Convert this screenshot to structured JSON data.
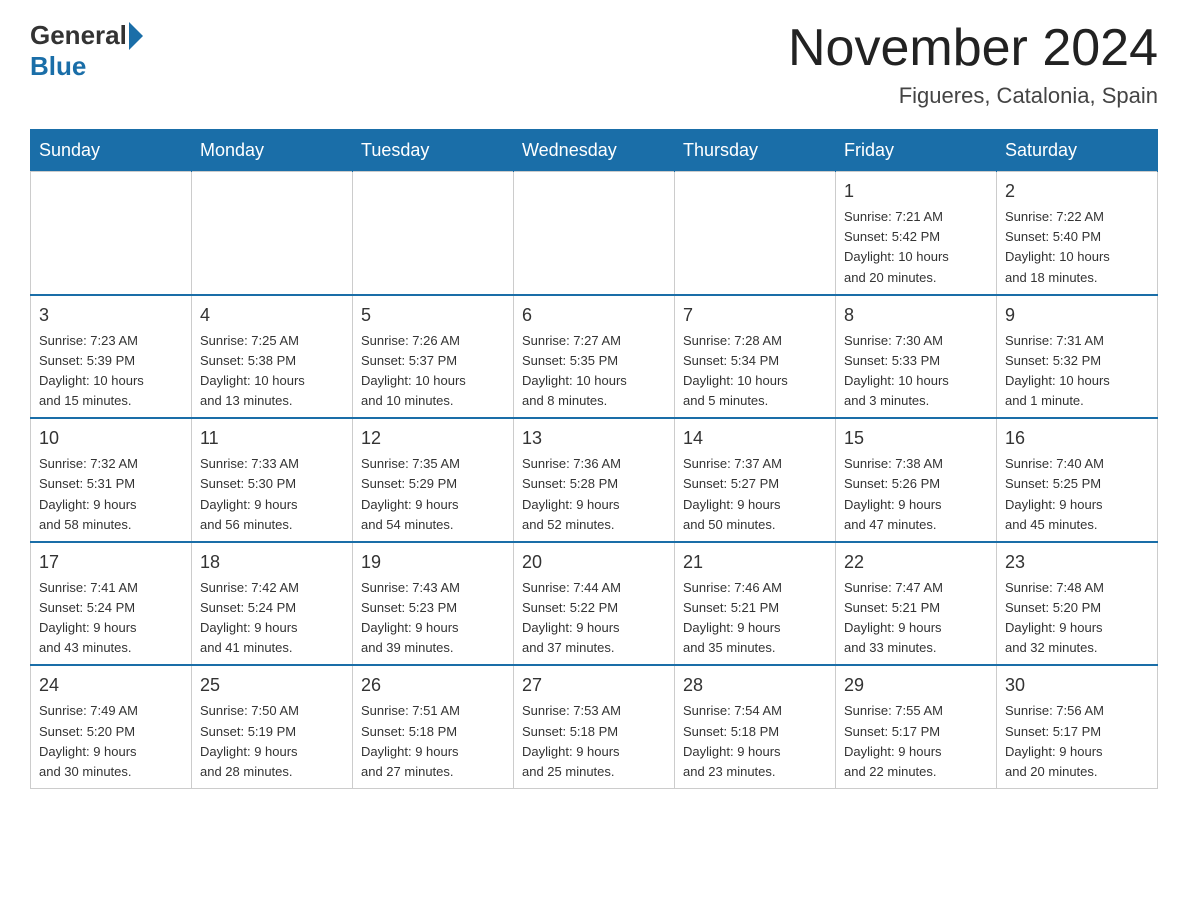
{
  "header": {
    "logo_general": "General",
    "logo_blue": "Blue",
    "title": "November 2024",
    "subtitle": "Figueres, Catalonia, Spain"
  },
  "weekdays": [
    "Sunday",
    "Monday",
    "Tuesday",
    "Wednesday",
    "Thursday",
    "Friday",
    "Saturday"
  ],
  "weeks": [
    [
      {
        "day": "",
        "info": ""
      },
      {
        "day": "",
        "info": ""
      },
      {
        "day": "",
        "info": ""
      },
      {
        "day": "",
        "info": ""
      },
      {
        "day": "",
        "info": ""
      },
      {
        "day": "1",
        "info": "Sunrise: 7:21 AM\nSunset: 5:42 PM\nDaylight: 10 hours\nand 20 minutes."
      },
      {
        "day": "2",
        "info": "Sunrise: 7:22 AM\nSunset: 5:40 PM\nDaylight: 10 hours\nand 18 minutes."
      }
    ],
    [
      {
        "day": "3",
        "info": "Sunrise: 7:23 AM\nSunset: 5:39 PM\nDaylight: 10 hours\nand 15 minutes."
      },
      {
        "day": "4",
        "info": "Sunrise: 7:25 AM\nSunset: 5:38 PM\nDaylight: 10 hours\nand 13 minutes."
      },
      {
        "day": "5",
        "info": "Sunrise: 7:26 AM\nSunset: 5:37 PM\nDaylight: 10 hours\nand 10 minutes."
      },
      {
        "day": "6",
        "info": "Sunrise: 7:27 AM\nSunset: 5:35 PM\nDaylight: 10 hours\nand 8 minutes."
      },
      {
        "day": "7",
        "info": "Sunrise: 7:28 AM\nSunset: 5:34 PM\nDaylight: 10 hours\nand 5 minutes."
      },
      {
        "day": "8",
        "info": "Sunrise: 7:30 AM\nSunset: 5:33 PM\nDaylight: 10 hours\nand 3 minutes."
      },
      {
        "day": "9",
        "info": "Sunrise: 7:31 AM\nSunset: 5:32 PM\nDaylight: 10 hours\nand 1 minute."
      }
    ],
    [
      {
        "day": "10",
        "info": "Sunrise: 7:32 AM\nSunset: 5:31 PM\nDaylight: 9 hours\nand 58 minutes."
      },
      {
        "day": "11",
        "info": "Sunrise: 7:33 AM\nSunset: 5:30 PM\nDaylight: 9 hours\nand 56 minutes."
      },
      {
        "day": "12",
        "info": "Sunrise: 7:35 AM\nSunset: 5:29 PM\nDaylight: 9 hours\nand 54 minutes."
      },
      {
        "day": "13",
        "info": "Sunrise: 7:36 AM\nSunset: 5:28 PM\nDaylight: 9 hours\nand 52 minutes."
      },
      {
        "day": "14",
        "info": "Sunrise: 7:37 AM\nSunset: 5:27 PM\nDaylight: 9 hours\nand 50 minutes."
      },
      {
        "day": "15",
        "info": "Sunrise: 7:38 AM\nSunset: 5:26 PM\nDaylight: 9 hours\nand 47 minutes."
      },
      {
        "day": "16",
        "info": "Sunrise: 7:40 AM\nSunset: 5:25 PM\nDaylight: 9 hours\nand 45 minutes."
      }
    ],
    [
      {
        "day": "17",
        "info": "Sunrise: 7:41 AM\nSunset: 5:24 PM\nDaylight: 9 hours\nand 43 minutes."
      },
      {
        "day": "18",
        "info": "Sunrise: 7:42 AM\nSunset: 5:24 PM\nDaylight: 9 hours\nand 41 minutes."
      },
      {
        "day": "19",
        "info": "Sunrise: 7:43 AM\nSunset: 5:23 PM\nDaylight: 9 hours\nand 39 minutes."
      },
      {
        "day": "20",
        "info": "Sunrise: 7:44 AM\nSunset: 5:22 PM\nDaylight: 9 hours\nand 37 minutes."
      },
      {
        "day": "21",
        "info": "Sunrise: 7:46 AM\nSunset: 5:21 PM\nDaylight: 9 hours\nand 35 minutes."
      },
      {
        "day": "22",
        "info": "Sunrise: 7:47 AM\nSunset: 5:21 PM\nDaylight: 9 hours\nand 33 minutes."
      },
      {
        "day": "23",
        "info": "Sunrise: 7:48 AM\nSunset: 5:20 PM\nDaylight: 9 hours\nand 32 minutes."
      }
    ],
    [
      {
        "day": "24",
        "info": "Sunrise: 7:49 AM\nSunset: 5:20 PM\nDaylight: 9 hours\nand 30 minutes."
      },
      {
        "day": "25",
        "info": "Sunrise: 7:50 AM\nSunset: 5:19 PM\nDaylight: 9 hours\nand 28 minutes."
      },
      {
        "day": "26",
        "info": "Sunrise: 7:51 AM\nSunset: 5:18 PM\nDaylight: 9 hours\nand 27 minutes."
      },
      {
        "day": "27",
        "info": "Sunrise: 7:53 AM\nSunset: 5:18 PM\nDaylight: 9 hours\nand 25 minutes."
      },
      {
        "day": "28",
        "info": "Sunrise: 7:54 AM\nSunset: 5:18 PM\nDaylight: 9 hours\nand 23 minutes."
      },
      {
        "day": "29",
        "info": "Sunrise: 7:55 AM\nSunset: 5:17 PM\nDaylight: 9 hours\nand 22 minutes."
      },
      {
        "day": "30",
        "info": "Sunrise: 7:56 AM\nSunset: 5:17 PM\nDaylight: 9 hours\nand 20 minutes."
      }
    ]
  ]
}
